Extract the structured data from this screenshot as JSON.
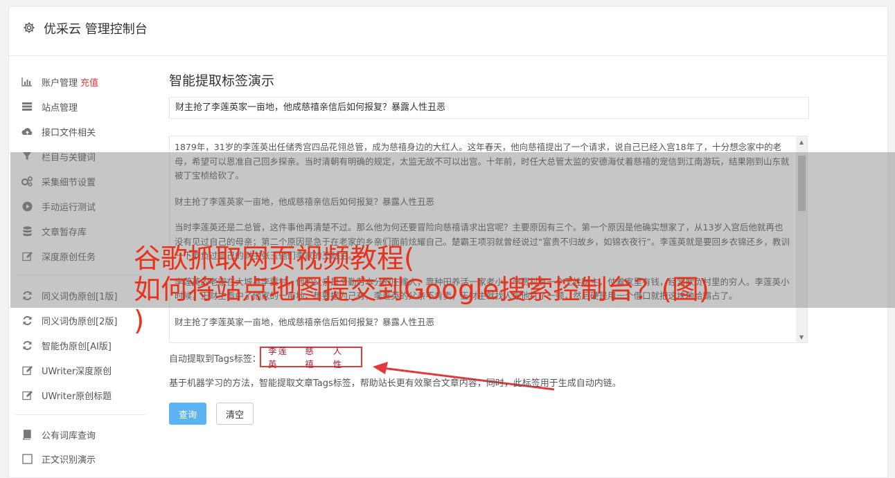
{
  "header": {
    "title": "优采云 管理控制台",
    "icon": "gear-icon"
  },
  "sidebar": {
    "items": [
      {
        "label": "账户管理",
        "badge": "充值",
        "icon": "bar-chart-icon"
      },
      {
        "label": "站点管理",
        "icon": "server-icon"
      },
      {
        "label": "接口文件相关",
        "icon": "cloud-upload-icon"
      },
      {
        "label": "栏目与关键词",
        "icon": "filter-icon"
      },
      {
        "label": "采集细节设置",
        "icon": "gears-icon"
      },
      {
        "label": "手动运行测试",
        "icon": "play-circle-icon"
      },
      {
        "label": "文章暂存库",
        "icon": "database-icon"
      },
      {
        "label": "深度原创任务",
        "icon": "edit-icon"
      },
      {
        "label": "同义词伪原创[1版]",
        "icon": "refresh-icon"
      },
      {
        "label": "同义词伪原创[2版]",
        "icon": "refresh-icon"
      },
      {
        "label": "智能伪原创[AI版]",
        "icon": "refresh-icon"
      },
      {
        "label": "UWriter深度原创",
        "icon": "edit-icon"
      },
      {
        "label": "UWriter原创标题",
        "icon": "edit-icon"
      },
      {
        "label": "公有词库查询",
        "icon": "book-icon"
      },
      {
        "label": "正文识别演示",
        "icon": "square-icon"
      }
    ]
  },
  "main": {
    "title": "智能提取标签演示",
    "title_input": "财主抢了李莲英家一亩地，他成慈禧亲信后如何报复？暴露人性丑恶",
    "content_paragraphs": [
      "1879年，31岁的李莲英出任储秀宫四品花翎总管，成为慈禧身边的大红人。这年春天，他向慈禧提出了一个请求，说自己已经入宫18年了，十分想念家中的老母，希望可以恩准自己回乡探亲。当时清朝有明确的规定，太监无故不可以出宫。十年前，时任大总管太监的安德海仗着慈禧的宠信到江南游玩，结果刚到山东就被丁宝桢给砍了。",
      "财主抢了李莲英家一亩地，他成慈禧亲信后如何报复？暴露人性丑恶",
      "当时李莲英还是二总管，这件事他再清楚不过。那么他为何还要冒险向慈禧请求出宫呢？主要原因有三个。第一个原因是他确实想家了，从13岁入宫后他就再也没有见过自己的母亲；第二个原因是急于在老家的乡亲们面前炫耀自己。楚霸王项羽就曾经说过“富贵不归故乡，如锦衣夜行”。李莲英就是要回乡衣锦还乡，教训一下欺负过自己的财主张玉他们李家的王财主。",
      "李莲英的老家在大城县李贾村，他的父亲是个勤劳本分的庄稼人，靠种田养活一家老小。李贾村有一个王姓财主，仗着家里有钱，经常欺负村里的穷人。李莲英小时候，王财主看中了他家的一亩地，想要据为己有，李莲英的父亲不肯卖，王财主就找人把他打了一顿，然后硬是用一个借口就把这块地给霸占了。",
      "财主抢了李莲英家一亩地，他成慈禧亲信后如何报复？暴露人性丑恶"
    ],
    "tags_label": "自动提取到Tags标签：",
    "tags": [
      "李莲英",
      "慈禧",
      "人性"
    ],
    "description": "基于机器学习的方法，智能提取文章Tags标签，帮助站长更有效聚合文章内容，同时，此标签用于生成自动内链。",
    "query_button": "查询",
    "clear_button": "清空"
  },
  "watermark": {
    "line1": "谷歌抓取网页视频教程(",
    "line2": "如何将站点地图提交到Google搜索控制台？(图)",
    "line3": ")"
  },
  "colors": {
    "primary": "#5db3f2",
    "accent_red": "#e4393c",
    "tag_text": "#a02033",
    "watermark_red": "#e8331c"
  }
}
